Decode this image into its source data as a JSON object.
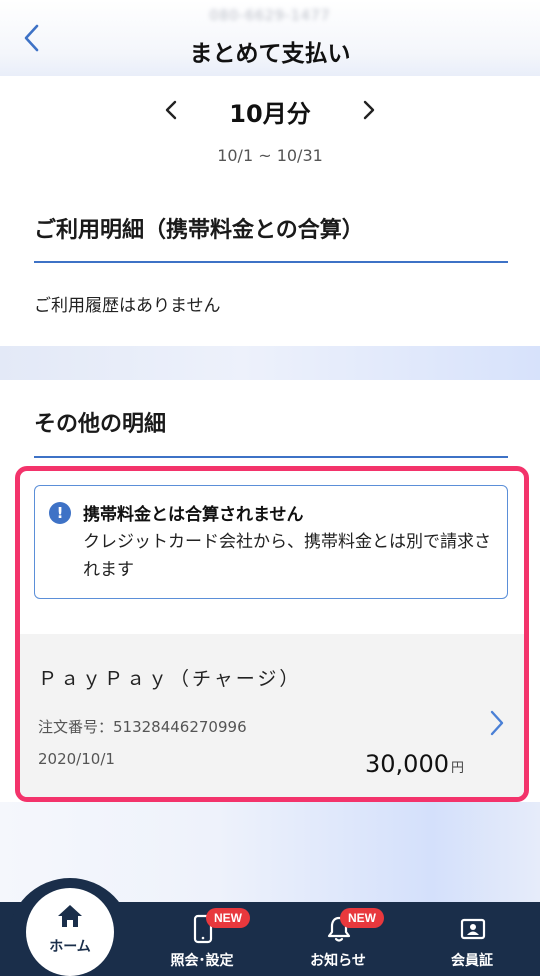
{
  "header": {
    "phone_masked": "080-6629-1477",
    "title": "まとめて支払い"
  },
  "month_nav": {
    "label": "10月分",
    "period": "10/1 ~ 10/31"
  },
  "usage_section": {
    "title": "ご利用明細（携帯料金との合算）",
    "empty_text": "ご利用履歴はありません"
  },
  "other_section": {
    "title": "その他の明細",
    "notice": {
      "title": "携帯料金とは合算されません",
      "body": "クレジットカード会社から、携帯料金とは別で請求されます"
    },
    "items": [
      {
        "name": "ＰａｙＰａｙ（チャージ）",
        "order_label": "注文番号：51328446270996",
        "date": "2020/10/1",
        "amount": "30,000",
        "currency": "円"
      }
    ]
  },
  "bottom_nav": {
    "home": "ホーム",
    "inquiry": "照会･設定",
    "notice": "お知らせ",
    "member": "会員証",
    "badge_new": "NEW"
  },
  "colors": {
    "accent": "#3e72c6",
    "highlight": "#f3336b",
    "nav_bg": "#1a2e4a",
    "badge": "#e8383d"
  }
}
